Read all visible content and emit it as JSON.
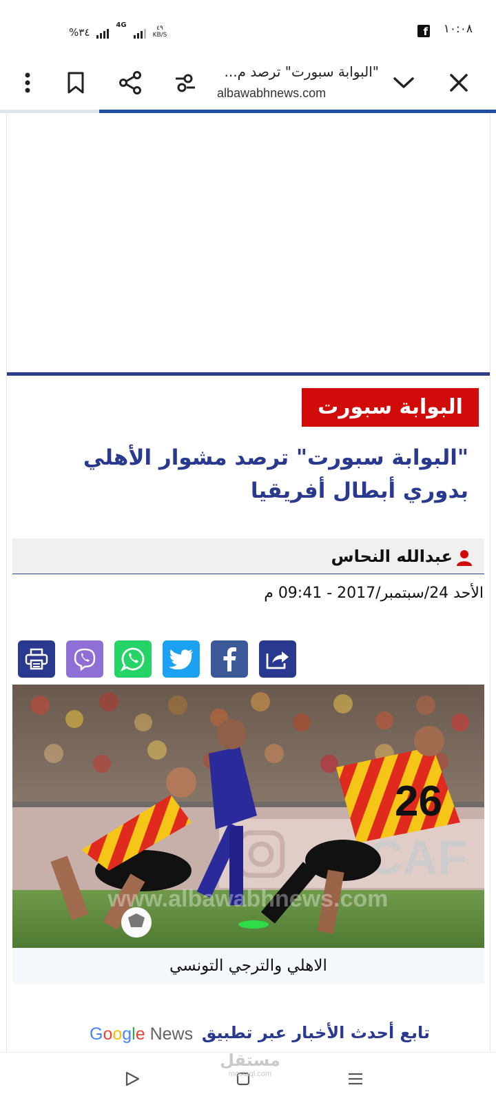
{
  "status_bar": {
    "time": "١٠:٠٨",
    "battery": "%٣٤",
    "network": "4G",
    "speed_value": "٤٩",
    "speed_unit": "KB/S",
    "notification_icon": "facebook-icon"
  },
  "browser": {
    "page_title": "\"البوابة سبورت\" ترصد م...",
    "url": "albawabhnews.com",
    "load_progress_percent": 80,
    "accent_color": "#1f4ea3"
  },
  "article": {
    "category": "البوابة سبورت",
    "headline": "\"البوابة سبورت\" ترصد مشوار الأهلي بدوري أبطال أفريقيا",
    "author": "عبدالله النحاس",
    "date": "الأحد 24/سبتمبر/2017 - 09:41 م",
    "image_caption": "الاهلي والترجي التونسي",
    "image_watermark": "www.albawabhnews.com",
    "headline_color": "#28398f",
    "badge_color": "#d10a0a"
  },
  "share_buttons": [
    {
      "name": "share",
      "icon": "share-arrow-icon",
      "color": "#28398f"
    },
    {
      "name": "facebook",
      "icon": "facebook-icon",
      "color": "#3b5998"
    },
    {
      "name": "twitter",
      "icon": "twitter-icon",
      "color": "#1da1f2"
    },
    {
      "name": "whatsapp",
      "icon": "whatsapp-icon",
      "color": "#25d366"
    },
    {
      "name": "viber",
      "icon": "viber-icon",
      "color": "#8f6fd6"
    },
    {
      "name": "print",
      "icon": "printer-icon",
      "color": "#28398f"
    }
  ],
  "follow": {
    "text": "تابع أحدث الأخبار عبر تطبيق",
    "brand_google": "Google",
    "brand_news": "News"
  },
  "nav_bar": {
    "watermark_main": "مستقل",
    "watermark_sub": "mostaql.com"
  }
}
